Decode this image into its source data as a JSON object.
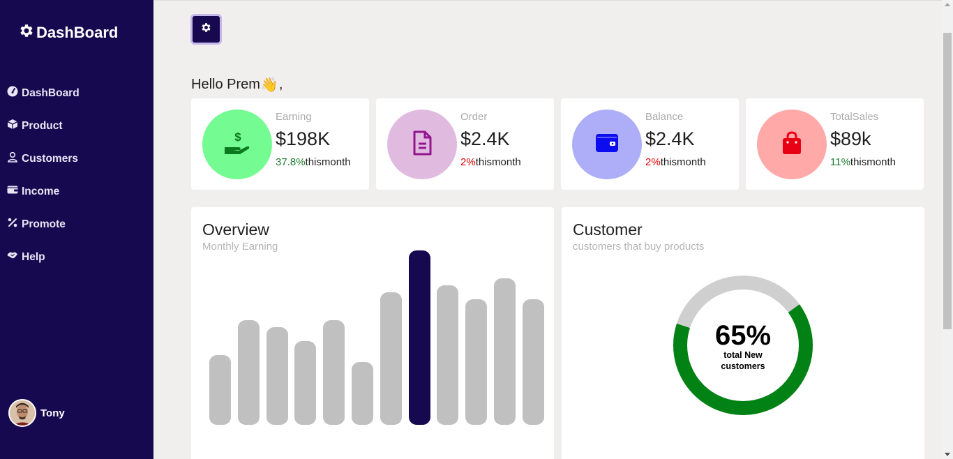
{
  "brand": {
    "title": "DashBoard",
    "icon": "gear-icon"
  },
  "sidebar": {
    "items": [
      {
        "label": "DashBoard",
        "icon": "gauge-icon"
      },
      {
        "label": "Product",
        "icon": "cube-icon"
      },
      {
        "label": "Customers",
        "icon": "user-icon"
      },
      {
        "label": "Income",
        "icon": "wallet-icon"
      },
      {
        "label": "Promote",
        "icon": "percent-icon"
      },
      {
        "label": "Help",
        "icon": "handshake-icon"
      }
    ],
    "user": {
      "name": "Tony"
    }
  },
  "header": {
    "greeting_name": "Hello Prem",
    "greeting_emoji": "👋",
    "greeting_suffix": ","
  },
  "cards": [
    {
      "label": "Earning",
      "value": "$198K",
      "change": "37.8%",
      "change_suffix": "thismonth",
      "trend": "positive",
      "icon": "dollar-hand-icon",
      "circle_color": "#74fb91",
      "icon_color": "#0b7a1e"
    },
    {
      "label": "Order",
      "value": "$2.4K",
      "change": "2%",
      "change_suffix": "thismonth",
      "trend": "negative",
      "icon": "document-icon",
      "circle_color": "#e0bbdf",
      "icon_color": "#93168f"
    },
    {
      "label": "Balance",
      "value": "$2.4K",
      "change": "2%",
      "change_suffix": "thismonth",
      "trend": "negative",
      "icon": "wallet-icon",
      "circle_color": "#aeaef8",
      "icon_color": "#0c0cf0"
    },
    {
      "label": "TotalSales",
      "value": "$89k",
      "change": "11%",
      "change_suffix": "thismonth",
      "trend": "positive",
      "icon": "shopping-bag-icon",
      "circle_color": "#ffa9a9",
      "icon_color": "#e80014"
    }
  ],
  "overview": {
    "title": "Overview",
    "subtitle": "Monthly Earning",
    "chart_data": {
      "type": "bar",
      "values": [
        50,
        75,
        70,
        60,
        75,
        45,
        95,
        125,
        100,
        90,
        105,
        90
      ],
      "active_index": 7,
      "ylim": [
        0,
        125
      ],
      "grid": false,
      "colors": {
        "bar": "#c0c0c0",
        "active": "#16094f"
      }
    }
  },
  "customer": {
    "title": "Customer",
    "subtitle": "customers that buy products",
    "donut": {
      "percent": 65,
      "value_label": "65%",
      "caption": "total New customers",
      "fill_color": "#028214",
      "track_color": "#cfcfcf"
    }
  },
  "colors": {
    "sidebar": "#16094f",
    "background": "#f1eeee"
  }
}
